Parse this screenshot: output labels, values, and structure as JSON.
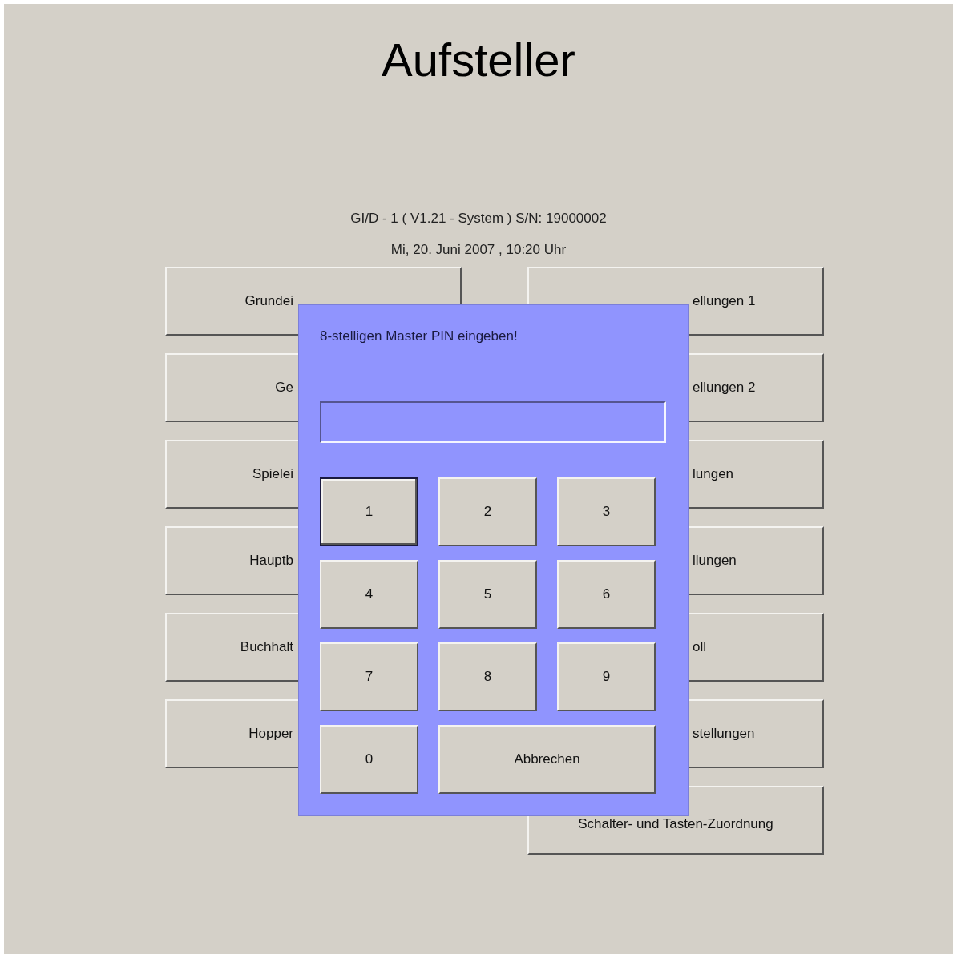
{
  "title": "Aufsteller",
  "device_info": "GI/D - 1 ( V1.21 - System  )  S/N: 19000002",
  "datetime": "Mi, 20. Juni 2007 , 10:20 Uhr",
  "menu_left": [
    {
      "label": "Grundei"
    },
    {
      "label": "Ge"
    },
    {
      "label": "Spielei"
    },
    {
      "label": "Hauptb"
    },
    {
      "label": "Buchhalt"
    },
    {
      "label": "Hopper"
    }
  ],
  "menu_right": [
    {
      "label": "ellungen 1"
    },
    {
      "label": "ellungen 2"
    },
    {
      "label": "lungen"
    },
    {
      "label": "llungen"
    },
    {
      "label": "oll"
    },
    {
      "label": "stellungen"
    },
    {
      "label": "Schalter- und Tasten-Zuordnung"
    }
  ],
  "pin_dialog": {
    "message": "8-stelligen Master PIN eingeben!",
    "keys": [
      {
        "label": "1",
        "focused": true
      },
      {
        "label": "2",
        "focused": false
      },
      {
        "label": "3",
        "focused": false
      },
      {
        "label": "4",
        "focused": false
      },
      {
        "label": "5",
        "focused": false
      },
      {
        "label": "6",
        "focused": false
      },
      {
        "label": "7",
        "focused": false
      },
      {
        "label": "8",
        "focused": false
      },
      {
        "label": "9",
        "focused": false
      },
      {
        "label": "0",
        "focused": false
      }
    ],
    "cancel": "Abbrechen"
  }
}
